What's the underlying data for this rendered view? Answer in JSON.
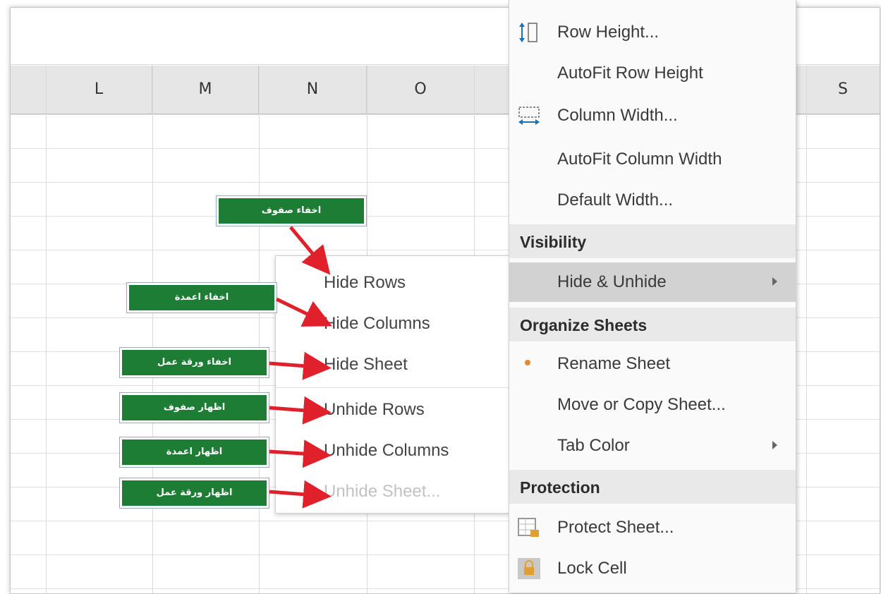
{
  "columns": [
    "L",
    "M",
    "N",
    "O",
    "S"
  ],
  "context_menu": {
    "items": [
      {
        "label": "Row Height...",
        "icon": "row-height-icon"
      },
      {
        "label": "AutoFit Row Height"
      },
      {
        "label": "Column Width...",
        "icon": "column-width-icon"
      },
      {
        "label": "AutoFit Column Width"
      },
      {
        "label": "Default Width..."
      }
    ],
    "section_visibility": "Visibility",
    "hide_unhide": "Hide & Unhide",
    "section_organize": "Organize Sheets",
    "organize_items": [
      {
        "label": "Rename Sheet"
      },
      {
        "label": "Move or Copy Sheet..."
      },
      {
        "label": "Tab Color"
      }
    ],
    "section_protection": "Protection",
    "protection_items": [
      {
        "label": "Protect Sheet...",
        "icon": "protect-sheet-icon"
      },
      {
        "label": "Lock Cell",
        "icon": "lock-cell-icon"
      }
    ]
  },
  "submenu": {
    "items": [
      {
        "label": "Hide Rows",
        "enabled": true
      },
      {
        "label": "Hide Columns",
        "enabled": true
      },
      {
        "label": "Hide Sheet",
        "enabled": true
      },
      {
        "label": "Unhide Rows",
        "enabled": true
      },
      {
        "label": "Unhide Columns",
        "enabled": true
      },
      {
        "label": "Unhide Sheet...",
        "enabled": false
      }
    ]
  },
  "annotations": [
    {
      "text": "اخفاء صفوف",
      "target": "Hide Rows"
    },
    {
      "text": "اخفاء اعمدة",
      "target": "Hide Columns"
    },
    {
      "text": "اخفاء ورقة عمل",
      "target": "Hide Sheet"
    },
    {
      "text": "اظهار صفوف",
      "target": "Unhide Rows"
    },
    {
      "text": "اظهار اعمدة",
      "target": "Unhide Columns"
    },
    {
      "text": "اظهار ورقة عمل",
      "target": "Unhide Sheet..."
    }
  ],
  "colors": {
    "annotation_bg": "#1e7d34",
    "arrow": "#e0202a",
    "menu_highlight": "#d2d2d2",
    "section_bg": "#e9e9e9"
  }
}
